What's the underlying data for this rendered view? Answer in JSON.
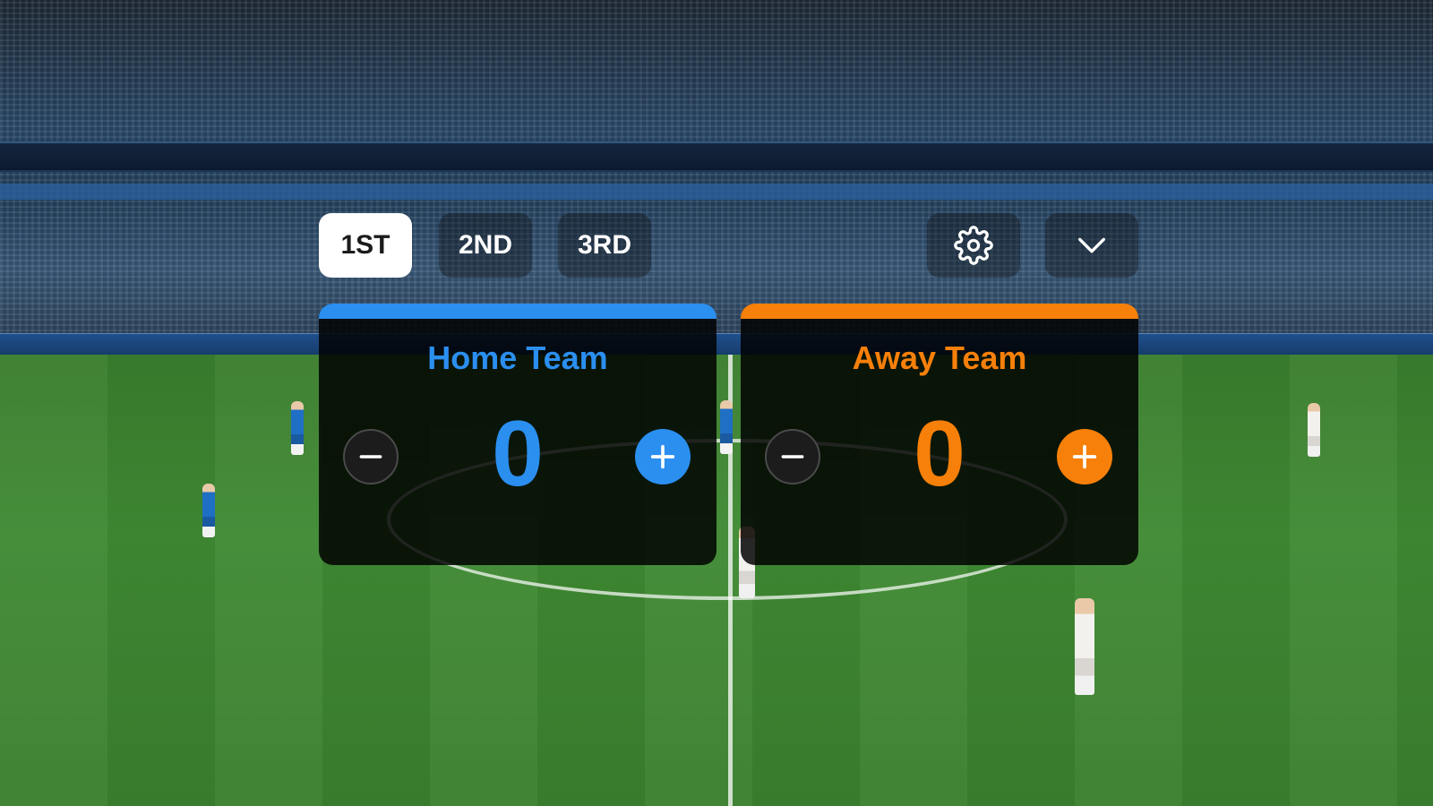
{
  "periods": {
    "tabs": [
      {
        "label": "1ST",
        "active": true
      },
      {
        "label": "2ND",
        "active": false
      },
      {
        "label": "3RD",
        "active": false
      }
    ]
  },
  "toolbar": {
    "settings_icon": "gear-icon",
    "collapse_icon": "chevron-down-icon"
  },
  "home": {
    "name": "Home Team",
    "score": "0",
    "color": "#2b8ff0",
    "decrement_icon": "minus-icon",
    "increment_icon": "plus-icon"
  },
  "away": {
    "name": "Away Team",
    "score": "0",
    "color": "#f7800a",
    "decrement_icon": "minus-icon",
    "increment_icon": "plus-icon"
  }
}
